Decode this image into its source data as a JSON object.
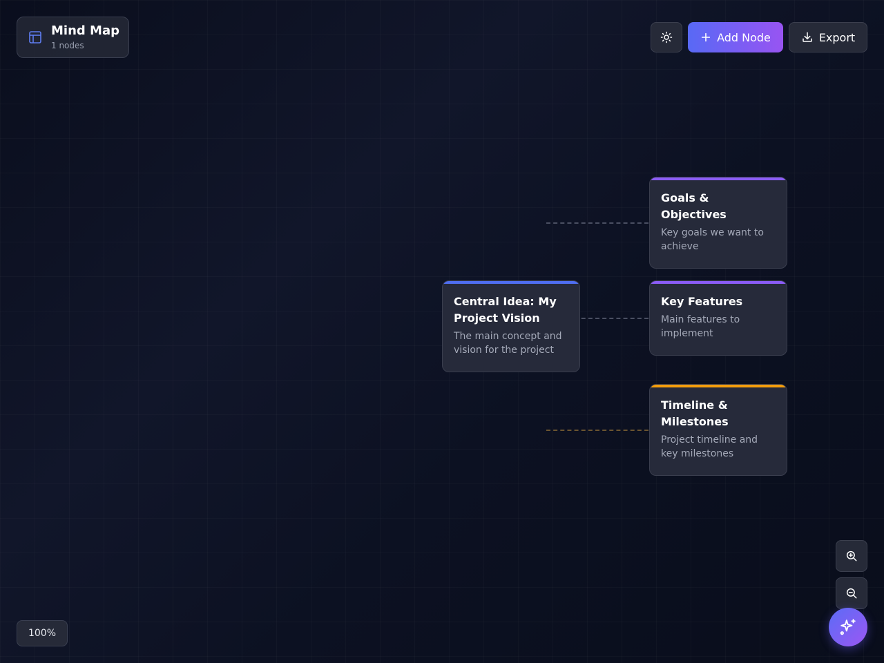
{
  "header": {
    "title": "Mind Map",
    "node_count": "1 nodes"
  },
  "toolbar": {
    "theme_icon": "sun-icon",
    "add_node_label": "Add Node",
    "export_label": "Export"
  },
  "nodes": [
    {
      "id": "central",
      "title": "Central Idea: My Project Vision",
      "description": "The main concept and vision for the project",
      "accent": "#4f6ef0"
    },
    {
      "id": "goals",
      "title": "Goals & Objectives",
      "description": "Key goals we want to achieve",
      "accent": "#8b5cf6"
    },
    {
      "id": "features",
      "title": "Key Features",
      "description": "Main features to implement",
      "accent": "#8b5cf6"
    },
    {
      "id": "timeline",
      "title": "Timeline & Milestones",
      "description": "Project timeline and key milestones",
      "accent": "#f59e0b"
    }
  ],
  "controls": {
    "zoom_level": "100%",
    "zoom_in_icon": "zoom-in-icon",
    "zoom_out_icon": "zoom-out-icon",
    "ai_icon": "sparkles-icon"
  },
  "colors": {
    "background": "#0b1020",
    "primary_gradient_start": "#5869f5",
    "primary_gradient_end": "#9854f2",
    "card_background": "#262a3a"
  }
}
